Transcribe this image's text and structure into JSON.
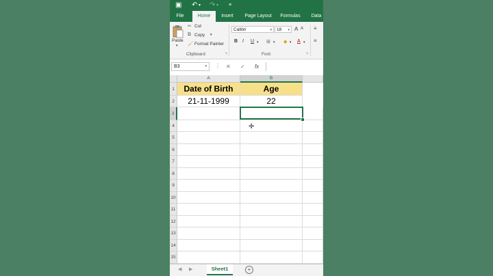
{
  "title_bar": {
    "save_icon": "save-icon",
    "undo_icon": "undo-icon",
    "redo_icon": "redo-icon",
    "customize_icon": "customize-icon"
  },
  "tabs": [
    {
      "label": "File",
      "active": false
    },
    {
      "label": "Home",
      "active": true
    },
    {
      "label": "Insert",
      "active": false
    },
    {
      "label": "Page Layout",
      "active": false
    },
    {
      "label": "Formulas",
      "active": false
    },
    {
      "label": "Data",
      "active": false
    }
  ],
  "clipboard": {
    "paste_label": "Paste",
    "cut_label": "Cut",
    "copy_label": "Copy",
    "format_painter_label": "Format Painter",
    "group_label": "Clipboard"
  },
  "font": {
    "font_name": "Calibri",
    "font_size": "18",
    "bold": "B",
    "italic": "I",
    "underline": "U",
    "font_color_glyph": "A",
    "group_label": "Font"
  },
  "formula_bar": {
    "name_box": "B3",
    "cancel_glyph": "✕",
    "enter_glyph": "✓",
    "fx_label": "fx",
    "formula_value": ""
  },
  "grid": {
    "columns": [
      "A",
      "B"
    ],
    "rows": [
      "1",
      "2",
      "3",
      "4",
      "5",
      "6",
      "7",
      "8",
      "9",
      "10",
      "11",
      "12",
      "13",
      "14",
      "15"
    ],
    "cells": {
      "A1": "Date of Birth",
      "B1": "Age",
      "A2": "21-11-1999",
      "B2": "22"
    },
    "header_fill": "#f7e08a",
    "selected_cell": "B3"
  },
  "sheet_tabs": {
    "active_label": "Sheet1",
    "add_icon": "add-sheet-icon"
  },
  "colors": {
    "brand": "#217346",
    "backdrop": "#4b8064"
  }
}
